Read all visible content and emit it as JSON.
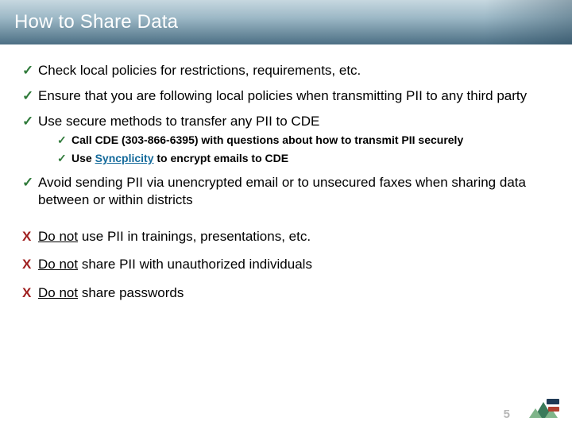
{
  "header": {
    "title": "How to Share Data"
  },
  "marks": {
    "check": "✓",
    "x": "X"
  },
  "bullets": [
    "Check local policies for restrictions, requirements, etc.",
    "Ensure that you are following local policies when transmitting PII to any third party",
    "Use secure methods to transfer any PII to CDE",
    "Avoid sending PII via unencrypted email or to unsecured faxes when sharing data between or within districts"
  ],
  "sub": [
    "Call CDE (303-866-6395) with questions about how to transmit PII securely",
    {
      "prefix": "Use",
      "link": "Syncplicity",
      "suffix": "to encrypt emails to CDE"
    }
  ],
  "donot": {
    "label": "Do not",
    "items": [
      "use PII in trainings, presentations, etc.",
      "share PII with unauthorized individuals",
      "share passwords"
    ]
  },
  "footer": {
    "page": "5"
  }
}
